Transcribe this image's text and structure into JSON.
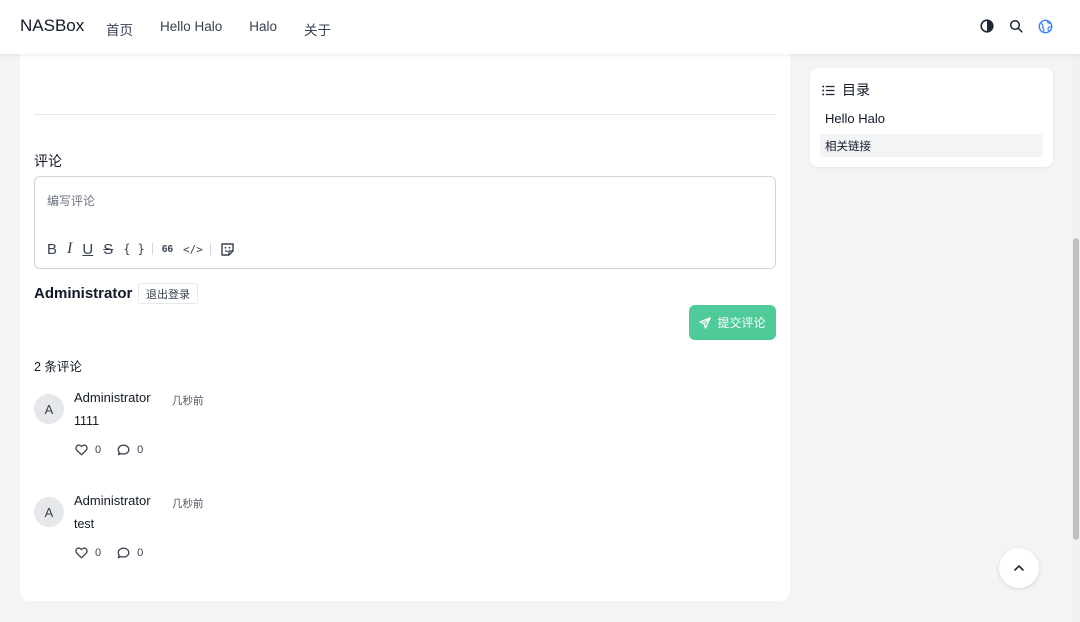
{
  "header": {
    "brand": "NASBox",
    "nav": [
      "首页",
      "Hello Halo",
      "Halo",
      "关于"
    ]
  },
  "icons": {
    "theme": "contrast-icon",
    "search": "search-icon",
    "language": "globe-icon"
  },
  "comments_section": {
    "title": "评论",
    "editor_placeholder": "编写评论",
    "toolbar": {
      "bold": "B",
      "italic": "I",
      "underline": "U",
      "strike": "S",
      "code": "{ }",
      "quote": "66",
      "code_block": "</>"
    },
    "user_name": "Administrator",
    "logout_label": "退出登录",
    "submit_label": "提交评论",
    "submit_color": "#4fcb9a",
    "count_label": "2 条评论",
    "comments": [
      {
        "avatar": "A",
        "author": "Administrator",
        "time": "几秒前",
        "body": "1111",
        "likes": "0",
        "replies": "0"
      },
      {
        "avatar": "A",
        "author": "Administrator",
        "time": "几秒前",
        "body": "test",
        "likes": "0",
        "replies": "0"
      }
    ]
  },
  "toc": {
    "title": "目录",
    "items": [
      "Hello Halo",
      "相关链接"
    ]
  }
}
